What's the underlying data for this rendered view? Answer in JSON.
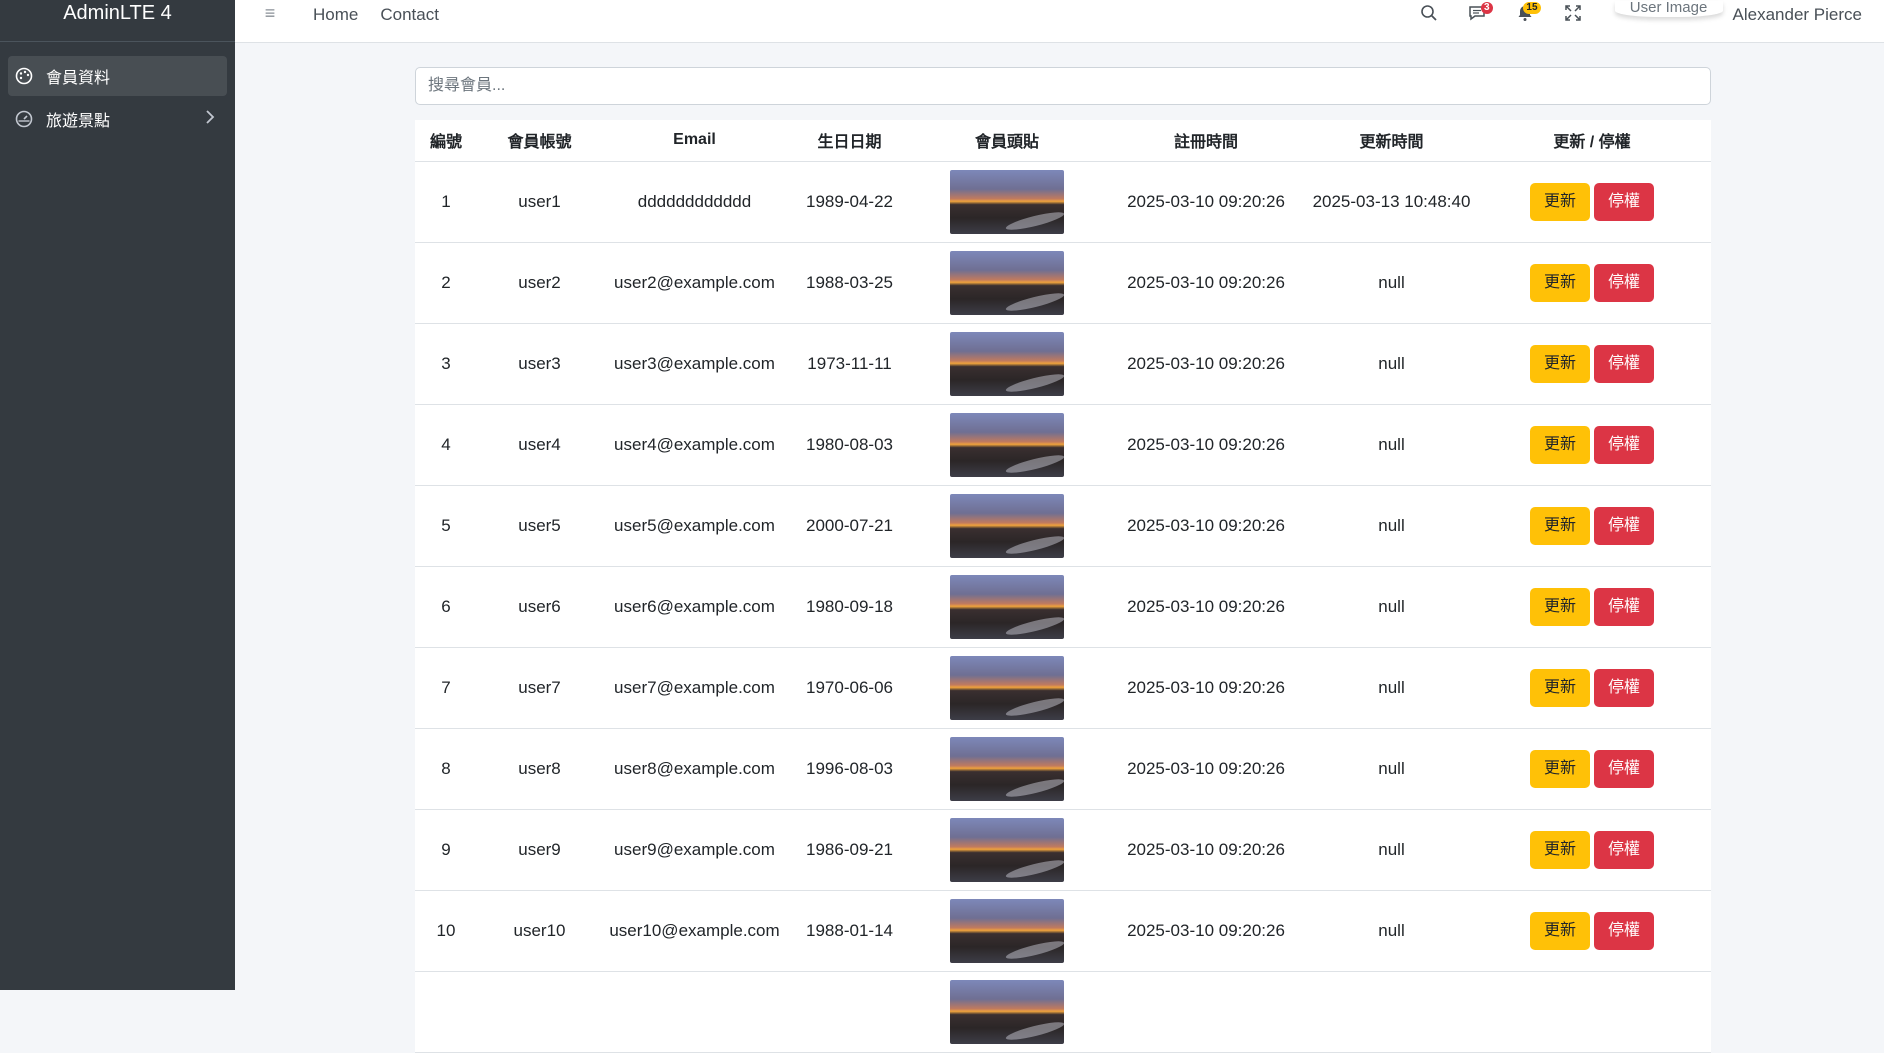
{
  "app": {
    "brand": "AdminLTE 4"
  },
  "sidebar": {
    "items": [
      {
        "label": "會員資料",
        "icon": "palette-icon",
        "active": true
      },
      {
        "label": "旅遊景點",
        "icon": "tachometer-icon",
        "active": false
      }
    ]
  },
  "topbar": {
    "nav": [
      "Home",
      "Contact"
    ],
    "messages_badge": "3",
    "notifications_badge": "15",
    "user_image_alt": "User Image",
    "user_name": "Alexander Pierce"
  },
  "search": {
    "placeholder": "搜尋會員..."
  },
  "table": {
    "headers": [
      "編號",
      "會員帳號",
      "Email",
      "生日日期",
      "會員頭貼",
      "註冊時間",
      "更新時間",
      "更新 / 停權"
    ],
    "update_label": "更新",
    "suspend_label": "停權",
    "rows": [
      {
        "id": "1",
        "account": "user1",
        "email": "dddddddddddd",
        "birthday": "1989-04-22",
        "registered": "2025-03-10 09:20:26",
        "updated": "2025-03-13 10:48:40"
      },
      {
        "id": "2",
        "account": "user2",
        "email": "user2@example.com",
        "birthday": "1988-03-25",
        "registered": "2025-03-10 09:20:26",
        "updated": "null"
      },
      {
        "id": "3",
        "account": "user3",
        "email": "user3@example.com",
        "birthday": "1973-11-11",
        "registered": "2025-03-10 09:20:26",
        "updated": "null"
      },
      {
        "id": "4",
        "account": "user4",
        "email": "user4@example.com",
        "birthday": "1980-08-03",
        "registered": "2025-03-10 09:20:26",
        "updated": "null"
      },
      {
        "id": "5",
        "account": "user5",
        "email": "user5@example.com",
        "birthday": "2000-07-21",
        "registered": "2025-03-10 09:20:26",
        "updated": "null"
      },
      {
        "id": "6",
        "account": "user6",
        "email": "user6@example.com",
        "birthday": "1980-09-18",
        "registered": "2025-03-10 09:20:26",
        "updated": "null"
      },
      {
        "id": "7",
        "account": "user7",
        "email": "user7@example.com",
        "birthday": "1970-06-06",
        "registered": "2025-03-10 09:20:26",
        "updated": "null"
      },
      {
        "id": "8",
        "account": "user8",
        "email": "user8@example.com",
        "birthday": "1996-08-03",
        "registered": "2025-03-10 09:20:26",
        "updated": "null"
      },
      {
        "id": "9",
        "account": "user9",
        "email": "user9@example.com",
        "birthday": "1986-09-21",
        "registered": "2025-03-10 09:20:26",
        "updated": "null"
      },
      {
        "id": "10",
        "account": "user10",
        "email": "user10@example.com",
        "birthday": "1988-01-14",
        "registered": "2025-03-10 09:20:26",
        "updated": "null"
      }
    ]
  },
  "colors": {
    "sidebar": "#343a40",
    "warning": "#ffc107",
    "danger": "#dc3545"
  }
}
